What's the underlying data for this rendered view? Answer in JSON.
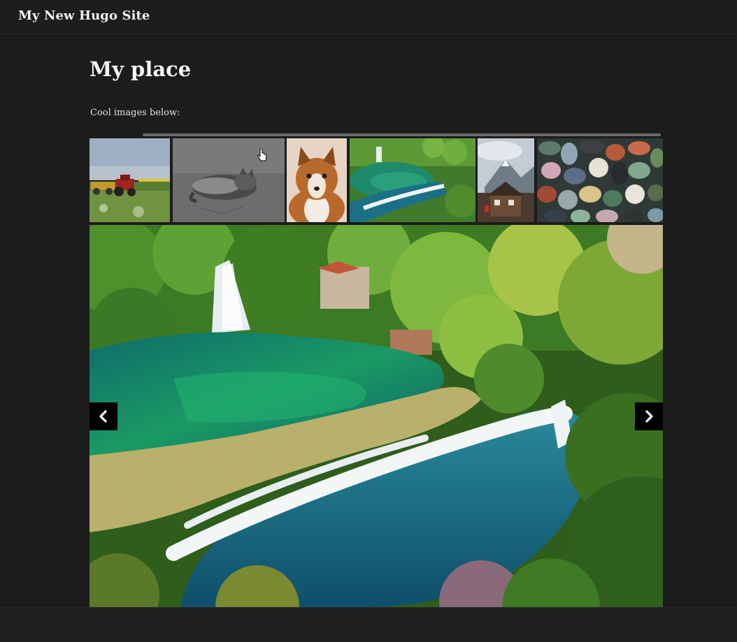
{
  "site": {
    "title": "My New Hugo Site"
  },
  "page": {
    "title": "My place",
    "intro": "Cool images below:"
  },
  "gallery": {
    "thumbnails": [
      {
        "icon": "tractor-field-image"
      },
      {
        "icon": "sleeping-cat-image"
      },
      {
        "icon": "dog-image"
      },
      {
        "icon": "waterfall-image"
      },
      {
        "icon": "mountain-village-image"
      },
      {
        "icon": "pebbles-image"
      }
    ],
    "main_image": {
      "icon": "waterfall-image"
    },
    "prev_icon": "chevron-left-icon",
    "next_icon": "chevron-right-icon"
  },
  "colors": {
    "background": "#1c1c1c",
    "topbar": "#1d1d1d",
    "button": "#000000"
  }
}
